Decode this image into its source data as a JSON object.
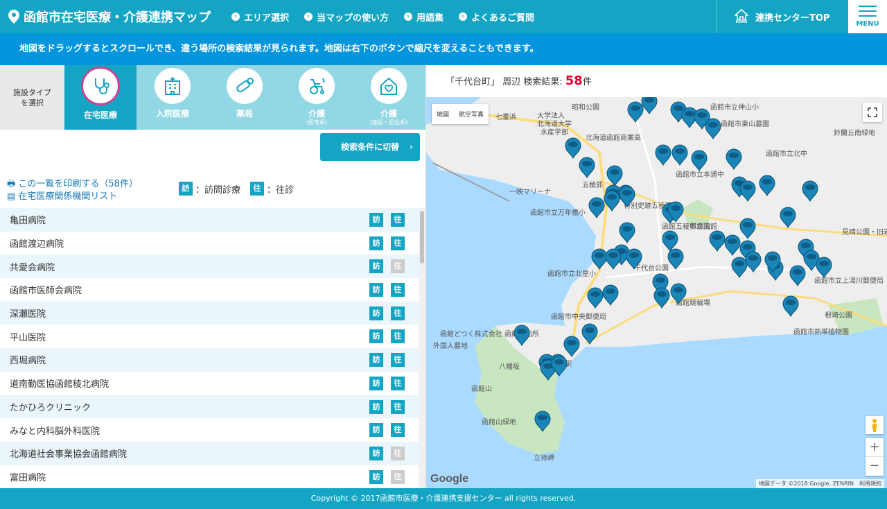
{
  "header": {
    "title": "函館市在宅医療・介護連携マップ",
    "nav": [
      "エリア選択",
      "当マップの使い方",
      "用語集",
      "よくあるご質問"
    ],
    "home_label": "連携センターTOP",
    "home_icon_text": "HOME",
    "menu_label": "MENU"
  },
  "notice": "地図をドラッグするとスクロールでき、違う場所の検索結果が見られます。地図は右下のボタンで縮尺を変えることもできます。",
  "facility_types": {
    "select_label_1": "施設タイプ",
    "select_label_2": "を選択",
    "tabs": [
      {
        "label": "在宅医療",
        "sub": "",
        "icon": "stethoscope-icon"
      },
      {
        "label": "入院医療",
        "sub": "",
        "icon": "hospital-icon"
      },
      {
        "label": "薬局",
        "sub": "",
        "icon": "pill-icon"
      },
      {
        "label": "介護",
        "sub": "(居宅系)",
        "icon": "wheelchair-icon"
      },
      {
        "label": "介護",
        "sub": "(施設・居住系)",
        "icon": "care-home-icon"
      }
    ],
    "active_tab": "在宅医療"
  },
  "switch_button": "検索条件に切替",
  "links": {
    "print": "この一覧を印刷する（58件）",
    "list": "在宅医療関係機関リスト"
  },
  "legend": {
    "visit_badge": "訪",
    "visit_text": "：訪問診療",
    "house_badge": "往",
    "house_text": "：往診"
  },
  "facilities": [
    {
      "name": "亀田病院",
      "visit": true,
      "house": true
    },
    {
      "name": "函館渡辺病院",
      "visit": true,
      "house": true
    },
    {
      "name": "共愛会病院",
      "visit": true,
      "house": false
    },
    {
      "name": "函館市医師会病院",
      "visit": true,
      "house": true
    },
    {
      "name": "深瀬医院",
      "visit": true,
      "house": true
    },
    {
      "name": "平山医院",
      "visit": true,
      "house": true
    },
    {
      "name": "西堀病院",
      "visit": true,
      "house": true
    },
    {
      "name": "道南勤医協函館稜北病院",
      "visit": true,
      "house": true
    },
    {
      "name": "たかひろクリニック",
      "visit": true,
      "house": true
    },
    {
      "name": "みなと内科脳外科医院",
      "visit": true,
      "house": true
    },
    {
      "name": "北海道社会事業協会函館病院",
      "visit": true,
      "house": false
    },
    {
      "name": "富田病院",
      "visit": true,
      "house": false
    }
  ],
  "result": {
    "prefix": "「千代台町」 周辺 検索結果: ",
    "count": "58",
    "suffix": "件"
  },
  "map": {
    "type_map": "地図",
    "type_satellite": "航空写真",
    "zoom_in": "+",
    "zoom_out": "−",
    "logo": "Google",
    "attribution": "地図データ ©2018 Google, ZENRIN　利用規約",
    "labels": [
      "昭和公園",
      "函館市立神山小",
      "大学法人",
      "北海道大学",
      "水産学部",
      "七重浜",
      "函館市東山墓園",
      "鈴蘭丘南緑地",
      "北海道函館商業高",
      "函館市立北中",
      "函館市立本通中",
      "五稜郭",
      "一映マリーナ",
      "函館市立万年橋小",
      "特別史跡五稜郭",
      "市立函館",
      "函館五稜郭病院",
      "見晴公園・旧岩船氏庭園",
      "函館市立北星小",
      "千代台公園",
      "函館市立上湯川郵便局",
      "函館どつく株式会社 函館造船所",
      "根崎公園",
      "函館市中央郵便局",
      "函館競輪場",
      "函館市熱帯植物園",
      "外国人墓地",
      "八幡坂",
      "函館山",
      "函館山緑地",
      "立待岬",
      "函館駅"
    ]
  },
  "footer": "Copyright © 2017函館市医療・介護連携支援センター all rights reserved."
}
